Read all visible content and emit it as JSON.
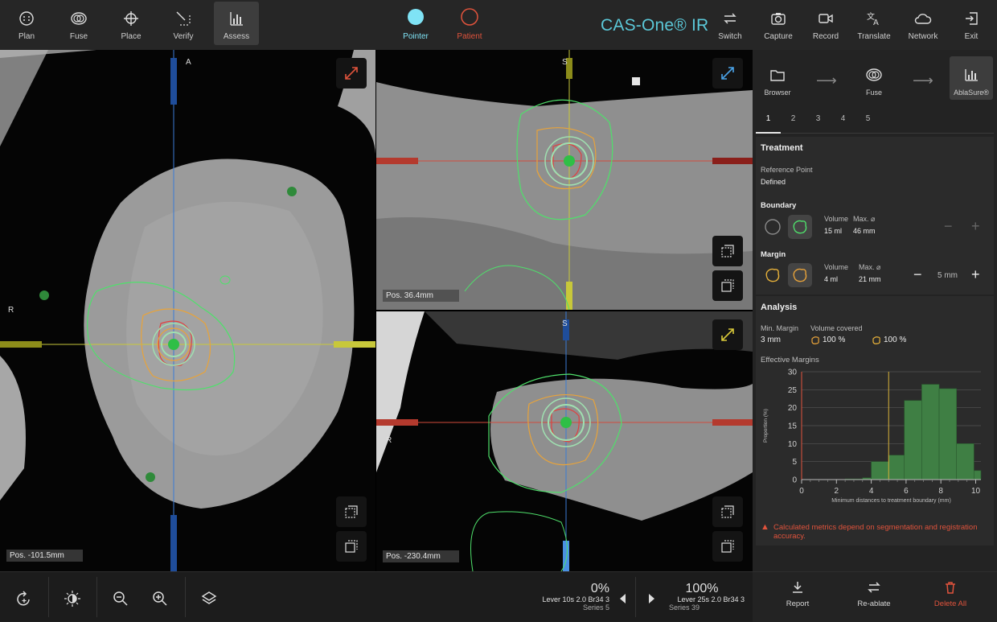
{
  "toolbar": {
    "left": [
      {
        "label": "Plan",
        "icon": "plan-icon"
      },
      {
        "label": "Fuse",
        "icon": "fuse-icon"
      },
      {
        "label": "Place",
        "icon": "place-icon"
      },
      {
        "label": "Verify",
        "icon": "verify-icon"
      },
      {
        "label": "Assess",
        "icon": "assess-icon",
        "active": true
      }
    ],
    "mode": [
      {
        "label": "Pointer",
        "color": "#7fe3f5"
      },
      {
        "label": "Patient",
        "color": "#e0533c"
      }
    ],
    "brand": "CAS-One® IR",
    "right": [
      {
        "label": "Switch",
        "icon": "switch-icon"
      },
      {
        "label": "Capture",
        "icon": "camera-icon"
      },
      {
        "label": "Record",
        "icon": "video-icon"
      },
      {
        "label": "Translate",
        "icon": "translate-icon"
      },
      {
        "label": "Network",
        "icon": "cloud-icon"
      },
      {
        "label": "Exit",
        "icon": "exit-icon"
      }
    ]
  },
  "viewports": {
    "axial": {
      "pos": "Pos. -101.5mm",
      "top": "A",
      "left": "R"
    },
    "sagittal": {
      "pos": "Pos. 36.4mm",
      "top": "S"
    },
    "coronal": {
      "pos": "Pos. -230.4mm",
      "top": "S",
      "left": "R"
    }
  },
  "workflow": [
    {
      "label": "Browser",
      "icon": "folder-icon"
    },
    {
      "label": "Fuse",
      "icon": "fuse-icon"
    },
    {
      "label": "AblaSure®",
      "icon": "chart-icon",
      "active": true
    }
  ],
  "tabs": [
    "1",
    "2",
    "3",
    "4",
    "5"
  ],
  "treatment": {
    "title": "Treatment",
    "ref_label": "Reference Point",
    "ref_value": "Defined",
    "boundary": {
      "title": "Boundary",
      "vol_label": "Volume",
      "vol": "15 ml",
      "max_label": "Max. ⌀",
      "max": "46 mm"
    },
    "margin": {
      "title": "Margin",
      "vol_label": "Volume",
      "vol": "4 ml",
      "max_label": "Max. ⌀",
      "max": "21 mm",
      "step": "5 mm"
    }
  },
  "analysis": {
    "title": "Analysis",
    "min_margin_label": "Min. Margin",
    "min_margin": "3 mm",
    "covered_label": "Volume covered",
    "covered_1": "100 %",
    "covered_2": "100 %",
    "eff_title": "Effective Margins",
    "warning": "Calculated metrics depend on segmentation and registration accuracy."
  },
  "chart_data": {
    "type": "bar",
    "xlabel": "Minimum distances to treatment boundary (mm)",
    "ylabel": "Proportion (%)",
    "xlim": [
      0,
      10.3
    ],
    "ylim": [
      0,
      30
    ],
    "xticks": [
      0,
      2,
      4,
      6,
      8,
      10
    ],
    "yticks": [
      0,
      5,
      10,
      15,
      20,
      25,
      30
    ],
    "bins": [
      {
        "x0": 2.5,
        "x1": 3.5,
        "value": 0.2
      },
      {
        "x0": 3.5,
        "x1": 4.0,
        "value": 0.5
      },
      {
        "x0": 4.0,
        "x1": 5.0,
        "value": 5.0
      },
      {
        "x0": 5.0,
        "x1": 5.9,
        "value": 6.8
      },
      {
        "x0": 5.9,
        "x1": 6.9,
        "value": 22.0
      },
      {
        "x0": 6.9,
        "x1": 7.9,
        "value": 26.5
      },
      {
        "x0": 7.9,
        "x1": 8.9,
        "value": 25.3
      },
      {
        "x0": 8.9,
        "x1": 9.9,
        "value": 10.0
      },
      {
        "x0": 9.9,
        "x1": 10.3,
        "value": 2.5
      }
    ],
    "bar_color": "#3f7f44",
    "lines": [
      {
        "x": 0,
        "color": "#e0533c"
      },
      {
        "x": 5,
        "color": "#d8b23a"
      }
    ],
    "grid": true
  },
  "window_level": {
    "left": {
      "pct": "0%",
      "line1": "Lever 10s  2.0  Br34  3",
      "line2": "Series 5"
    },
    "right": {
      "pct": "100%",
      "line1": "Lever 25s  2.0  Br34  3",
      "line2": "Series 39"
    }
  },
  "actions": [
    {
      "label": "Report",
      "color": "#d6d6d6"
    },
    {
      "label": "Re-ablate",
      "color": "#d6d6d6"
    },
    {
      "label": "Delete All",
      "color": "#e0533c"
    }
  ]
}
